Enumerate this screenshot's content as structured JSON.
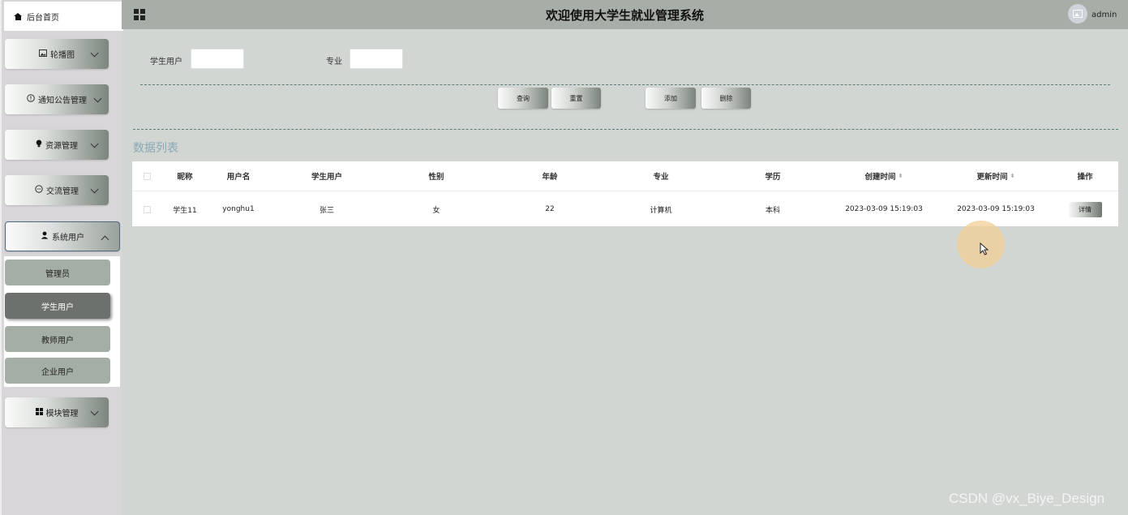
{
  "header": {
    "title": "欢迎使用大学生就业管理系统",
    "username": "admin"
  },
  "sidebar": {
    "home_label": "后台首页",
    "menus": [
      {
        "label": "轮播图",
        "icon": "image-icon"
      },
      {
        "label": "通知公告管理",
        "icon": "info-circle-icon"
      },
      {
        "label": "资源管理",
        "icon": "bulb-icon"
      },
      {
        "label": "交流管理",
        "icon": "chat-bubble-icon"
      },
      {
        "label": "系统用户",
        "icon": "user-icon",
        "expanded": true
      },
      {
        "label": "模块管理",
        "icon": "grid-icon"
      }
    ],
    "submenu": [
      {
        "label": "管理员"
      },
      {
        "label": "学生用户",
        "active": true
      },
      {
        "label": "教师用户"
      },
      {
        "label": "企业用户"
      }
    ]
  },
  "search": {
    "student_label": "学生用户",
    "student_value": "",
    "major_label": "专业",
    "major_value": ""
  },
  "actions": {
    "query": "查询",
    "reset": "重置",
    "add": "添加",
    "delete": "删除"
  },
  "section_title": "数据列表",
  "table": {
    "headers": [
      "昵称",
      "用户名",
      "学生用户",
      "性别",
      "年龄",
      "专业",
      "学历",
      "创建时间",
      "更新时间",
      "操作"
    ],
    "rows": [
      {
        "nickname": "学生11",
        "username": "yonghu1",
        "student": "张三",
        "gender": "女",
        "age": "22",
        "major": "计算机",
        "education": "本科",
        "created": "2023-03-09 15:19:03",
        "updated": "2023-03-09 15:19:03",
        "action": "详情"
      }
    ]
  },
  "watermark": "CSDN @vx_Biye_Design",
  "colors": {
    "topbar": "#a7ada7",
    "background": "#d1d6d3",
    "sidebar": "#d9d6da",
    "active_submenu": "#6d716e",
    "section_title": "#88a9b4"
  }
}
